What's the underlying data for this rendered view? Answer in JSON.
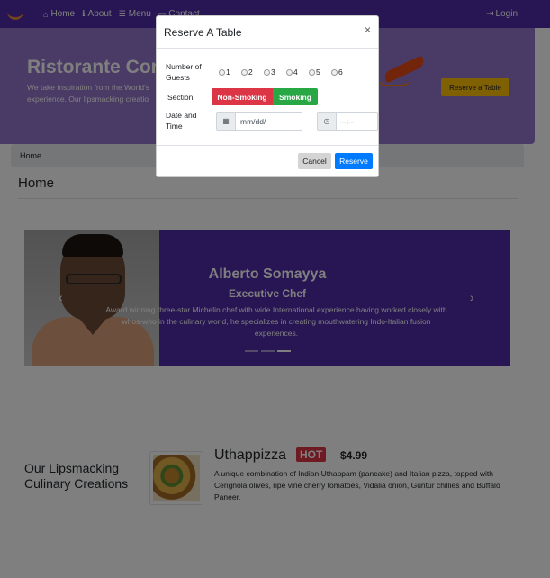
{
  "navbar": {
    "items": [
      {
        "icon": "home-icon",
        "label": "Home"
      },
      {
        "icon": "info-icon",
        "label": "About"
      },
      {
        "icon": "list-icon",
        "label": "Menu"
      },
      {
        "icon": "address-card-icon",
        "label": "Contact"
      }
    ],
    "login": {
      "icon": "sign-in-icon",
      "label": "Login"
    }
  },
  "jumbotron": {
    "title": "Ristorante Con",
    "text": "We take inspiration from the World's experience. Our lipsmacking creatio",
    "button": "Reserve a Table"
  },
  "breadcrumb": {
    "home": "Home"
  },
  "page": {
    "title": "Home"
  },
  "carousel": {
    "name": "Alberto Somayya",
    "role": "Executive Chef",
    "description": "Award winning three-star Michelin chef with wide International experience having worked closely with whos-who in the culinary world, he specializes in creating mouthwatering Indo-Italian fusion experiences.",
    "prev": "‹",
    "next": "›"
  },
  "featured": {
    "heading": "Our Lipsmacking Culinary Creations",
    "dish_name": "Uthappizza",
    "badge": "HOT",
    "price": "$4.99",
    "description": "A unique combination of Indian Uthappam (pancake) and Italian pizza, topped with Cerignola olives, ripe vine cherry tomatoes, Vidalia onion, Guntur chillies and Buffalo Paneer."
  },
  "modal": {
    "title": "Reserve A Table",
    "close": "×",
    "guests_label": "Number of Guests",
    "guest_options": [
      "1",
      "2",
      "3",
      "4",
      "5",
      "6"
    ],
    "section_label": "Section",
    "section_options": {
      "non_smoking": "Non-Smoking",
      "smoking": "Smoking"
    },
    "datetime_label": "Date and Time",
    "date_placeholder": "mm/dd/",
    "time_placeholder": "--:--",
    "cancel": "Cancel",
    "reserve": "Reserve"
  },
  "colors": {
    "navbar": "#512da8",
    "jumbotron": "#9575cd",
    "danger": "#dc3545",
    "success": "#28a745",
    "primary": "#007bff",
    "warning": "#ffc107"
  }
}
